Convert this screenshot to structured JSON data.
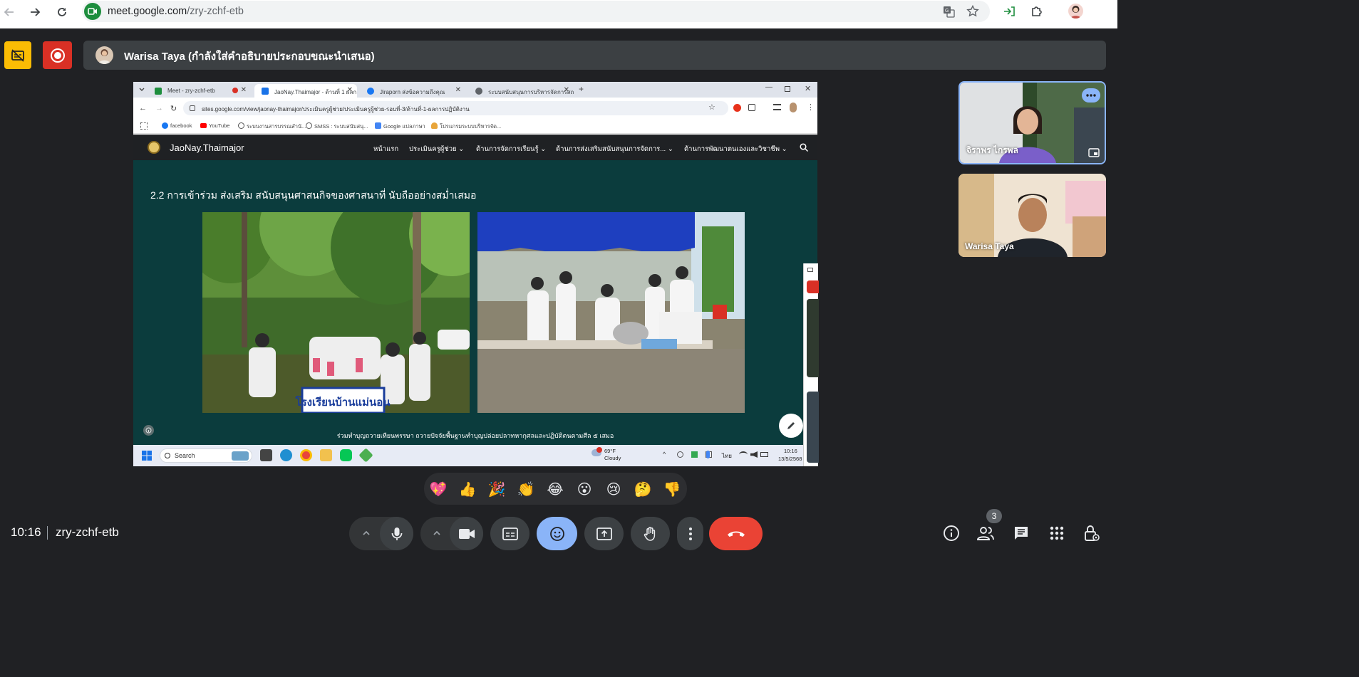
{
  "browser": {
    "url_domain": "meet.google.com",
    "url_path": "/zry-zchf-etb"
  },
  "presenter_banner": {
    "text": "Warisa Taya (กำลังใส่คำอธิบายประกอบขณะนำเสนอ)"
  },
  "shared_screen": {
    "tabs": [
      {
        "label": "Meet - zry-zchf-etb",
        "active": false
      },
      {
        "label": "JaoNay.Thaimajor - ด้านที่ 1 ผลก",
        "active": true
      },
      {
        "label": "Jiraporn ส่งข้อความถึงคุณ",
        "active": false
      },
      {
        "label": "ระบบสนับสนุนการบริหารจัดการสถาน",
        "active": false
      }
    ],
    "url": "sites.google.com/view/jaonay-thaimajor/ประเมินครูผู้ช่วย/ประเมินครูผู้ช่วย-รอบที่-3/ด้านที่-1-ผลการปฏิบัติงาน",
    "bookmarks": [
      "facebook",
      "YouTube",
      "ระบบงานสารบรรณสำนั...",
      "SMSS : ระบบสนับสนุ...",
      "Google แปลภาษา",
      "โปรแกรมระบบบริหารจัด..."
    ],
    "site_title": "JaoNay.Thaimajor",
    "site_nav": [
      "หน้าแรก",
      "ประเมินครูผู้ช่วย",
      "ด้านการจัดการเรียนรู้",
      "ด้านการส่งเสริมสนับสนุนการจัดการ...",
      "ด้านการพัฒนาตนเองและวิชาชีพ"
    ],
    "heading": "2.2 การเข้าร่วม ส่งเสริม สนับสนุนศาสนกิจของศาสนาที่ นับถืออย่างสม่ำเสมอ",
    "photo1_sign": "โรงเรียนบ้านแม่นอน",
    "caption": "ร่วมทำบุญถวายเทียนพรรษา ถวายปัจจัยพื้นฐานทำบุญปล่อยปลาทหากุศลและปฏิบัติตนตามศีล ๕ เสมอ",
    "taskbar": {
      "search_placeholder": "Search",
      "weather_temp": "69°F",
      "weather_cond": "Cloudy",
      "lang": "ไทย",
      "time": "10:16",
      "date": "13/5/2568"
    }
  },
  "participants": [
    {
      "name": "จิราพร ไกรพล"
    },
    {
      "name": "Warisa Taya"
    }
  ],
  "reactions": [
    "💖",
    "👍",
    "🎉",
    "👏",
    "😂",
    "😮",
    "😢",
    "🤔",
    "👎"
  ],
  "bottom_bar": {
    "time": "10:16",
    "meeting_code": "zry-zchf-etb",
    "people_count": "3"
  },
  "colors": {
    "meet_bg": "#202124",
    "captions_off": "#fbbc04",
    "recording": "#d93025",
    "leave_call": "#ea4335",
    "reactions_active": "#8ab4f8",
    "site_content_bg": "#0b3c3d"
  }
}
